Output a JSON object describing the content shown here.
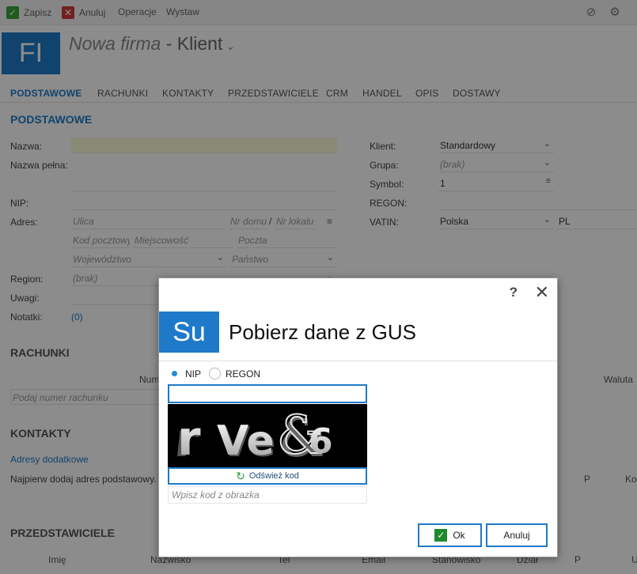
{
  "toolbar": {
    "save_label": "Zapisz",
    "cancel_label": "Anuluj",
    "operations_label": "Operacje",
    "issue_label": "Wystaw"
  },
  "header": {
    "logo_text": "FI",
    "title_italic": "Nowa firma",
    "title_separator": " - ",
    "title_main": "Klient"
  },
  "tabs": [
    {
      "label": "PODSTAWOWE"
    },
    {
      "label": "RACHUNKI"
    },
    {
      "label": "KONTAKTY"
    },
    {
      "label": "PRZEDSTAWICIELE"
    },
    {
      "label": "CRM"
    },
    {
      "label": "HANDEL"
    },
    {
      "label": "OPIS"
    },
    {
      "label": "DOSTAWY"
    }
  ],
  "basic": {
    "section_title": "PODSTAWOWE",
    "name_label": "Nazwa:",
    "fullname_label": "Nazwa pełna:",
    "nip_label": "NIP:",
    "address_label": "Adres:",
    "street_placeholder": "Ulica",
    "house_placeholder": "Nr domu",
    "slash": "/",
    "flat_placeholder": "Nr lokalu",
    "postal_placeholder": "Kod pocztowy",
    "city_placeholder": "Miejscowość",
    "post_placeholder": "Poczta",
    "voivodeship_placeholder": "Województwo",
    "country_placeholder": "Państwo",
    "region_label": "Region:",
    "region_value": "(brak)",
    "notes_label": "Uwagi:",
    "memo_label": "Notatki:",
    "memo_value": "(0)",
    "client_label": "Klient:",
    "client_value": "Standardowy",
    "group_label": "Grupa:",
    "group_value": "(brak)",
    "symbol_label": "Symbol:",
    "symbol_value": "1",
    "regon_label": "REGON:",
    "vatin_label": "VATIN:",
    "vatin_country": "Polska",
    "vatin_code": "PL"
  },
  "accounts": {
    "section_title": "RACHUNKI",
    "col_number": "Numer",
    "col_currency": "Waluta",
    "account_placeholder": "Podaj numer rachunku"
  },
  "contacts": {
    "section_title": "KONTAKTY",
    "extra_addresses_link": "Adresy dodatkowe",
    "hint": "Najpierw dodaj adres podstawowy.",
    "col_p": "P",
    "col_ko": "Ko"
  },
  "representatives": {
    "section_title": "PRZEDSTAWICIELE",
    "columns": [
      "Imię",
      "Nazwisko",
      "Tel",
      "Email",
      "Stanowisko",
      "Dział",
      "P",
      "U"
    ]
  },
  "dialog": {
    "help": "?",
    "close": "✕",
    "logo_text": "Su",
    "title": "Pobierz dane z GUS",
    "radio_nip": "NIP",
    "radio_regon": "REGON",
    "nip_value": "",
    "captcha_text": "rVe&6",
    "refresh_label": "Odśwież kod",
    "code_placeholder": "Wpisz kod z obrazka",
    "ok_label": "Ok",
    "cancel_label": "Anuluj"
  },
  "colors": {
    "accent": "#1e7ac9",
    "ok_green": "#1e8a2c"
  }
}
